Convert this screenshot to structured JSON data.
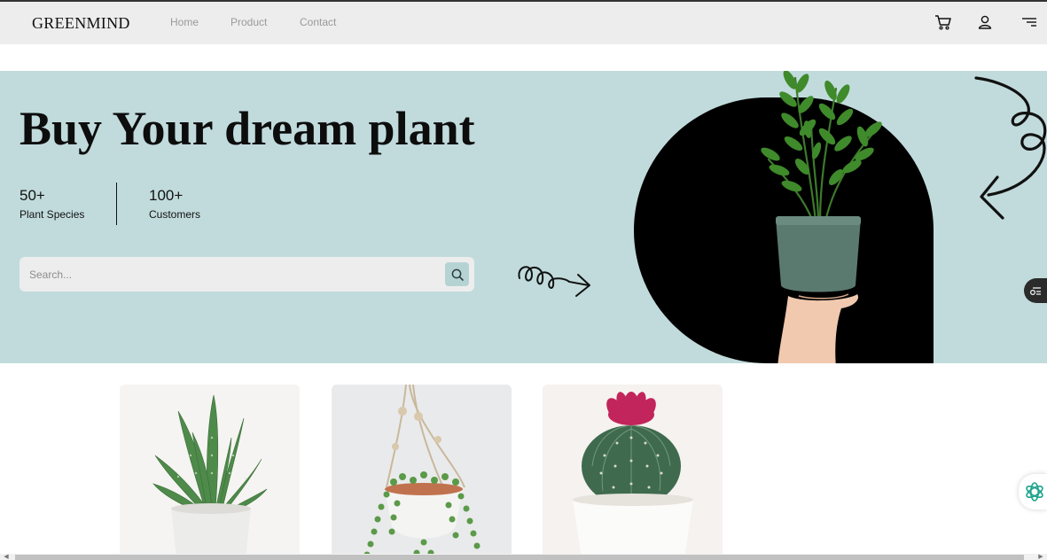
{
  "header": {
    "logo": "GREENMIND",
    "nav": [
      {
        "label": "Home"
      },
      {
        "label": "Product"
      },
      {
        "label": "Contact"
      }
    ],
    "icons": [
      "cart-icon",
      "user-icon",
      "menu-icon"
    ]
  },
  "hero": {
    "title": "Buy Your dream plant",
    "stats": [
      {
        "value": "50+",
        "label": "Plant Species"
      },
      {
        "value": "100+",
        "label": "Customers"
      }
    ],
    "search": {
      "placeholder": "Search...",
      "value": ""
    }
  },
  "products": [
    {
      "image": "aloe-plant-image"
    },
    {
      "image": "hanging-string-of-pearls-image"
    },
    {
      "image": "flowering-cactus-image"
    }
  ],
  "colors": {
    "navbar": "#ededed",
    "hero_background": "#c1dbdc",
    "accent_button": "#b6d3d4",
    "arch": "#000000"
  }
}
